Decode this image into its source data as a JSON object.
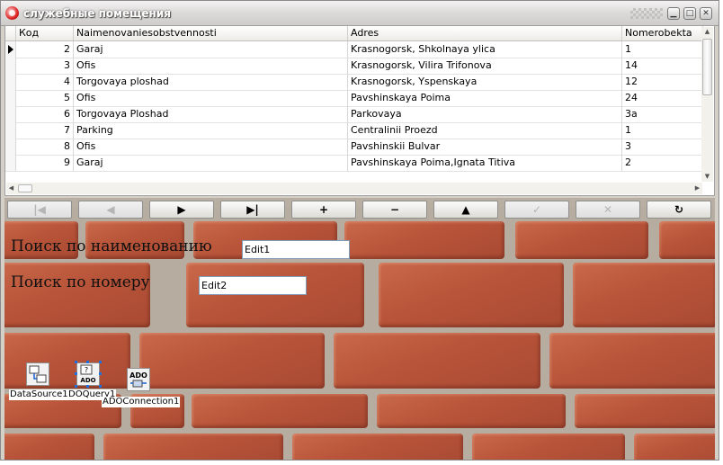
{
  "window": {
    "title": "служебные помещения"
  },
  "grid": {
    "columns": [
      "Код",
      "Naimenovaniesobstvennosti",
      "Adres",
      "Nomerobekta"
    ],
    "rows": [
      {
        "kod": "2",
        "name": "Garaj",
        "adres": "Krasnogorsk, Shkolnaya ylica",
        "nomer": "1"
      },
      {
        "kod": "3",
        "name": "Ofis",
        "adres": "Krasnogorsk, Vilira Trifonova",
        "nomer": "14"
      },
      {
        "kod": "4",
        "name": "Torgovaya ploshad",
        "adres": "Krasnogorsk, Yspenskaya",
        "nomer": "12"
      },
      {
        "kod": "5",
        "name": "Ofis",
        "adres": "Pavshinskaya Poima",
        "nomer": "24"
      },
      {
        "kod": "6",
        "name": "Torgovaya Ploshad",
        "adres": "Parkovaya",
        "nomer": "3a"
      },
      {
        "kod": "7",
        "name": "Parking",
        "adres": "Centralinii Proezd",
        "nomer": "1"
      },
      {
        "kod": "8",
        "name": "Ofis",
        "adres": "Pavshinskii Bulvar",
        "nomer": "3"
      },
      {
        "kod": "9",
        "name": "Garaj",
        "adres": "Pavshinskaya Poima,Ignata Titiva",
        "nomer": "2"
      }
    ],
    "current_row": 0
  },
  "navigator": {
    "buttons": [
      {
        "name": "nav-first-button",
        "glyph": "|◀",
        "enabled": false
      },
      {
        "name": "nav-prior-button",
        "glyph": "◀",
        "enabled": false
      },
      {
        "name": "nav-next-button",
        "glyph": "▶",
        "enabled": true
      },
      {
        "name": "nav-last-button",
        "glyph": "▶|",
        "enabled": true
      },
      {
        "name": "nav-insert-button",
        "glyph": "+",
        "enabled": true
      },
      {
        "name": "nav-delete-button",
        "glyph": "−",
        "enabled": true
      },
      {
        "name": "nav-edit-button",
        "glyph": "▲",
        "enabled": true
      },
      {
        "name": "nav-post-button",
        "glyph": "✓",
        "enabled": false
      },
      {
        "name": "nav-cancel-button",
        "glyph": "✕",
        "enabled": false
      },
      {
        "name": "nav-refresh-button",
        "glyph": "↻",
        "enabled": true
      }
    ]
  },
  "search": {
    "by_name_label": "Поиск по наименованию",
    "by_name_value": "Edit1",
    "by_number_label": "Поиск по номеру",
    "by_number_value": "Edit2"
  },
  "components": {
    "datasource": "DataSource1",
    "query": "ADOQuery1",
    "query_display": "DOQuery1",
    "connection": "ADOConnection1",
    "connection_display": "ADOConnection1",
    "ado_text": "ADO"
  },
  "colors": {
    "selection": "#1e6fe0",
    "brick": "#b85439",
    "mortar": "#b6ada0"
  }
}
